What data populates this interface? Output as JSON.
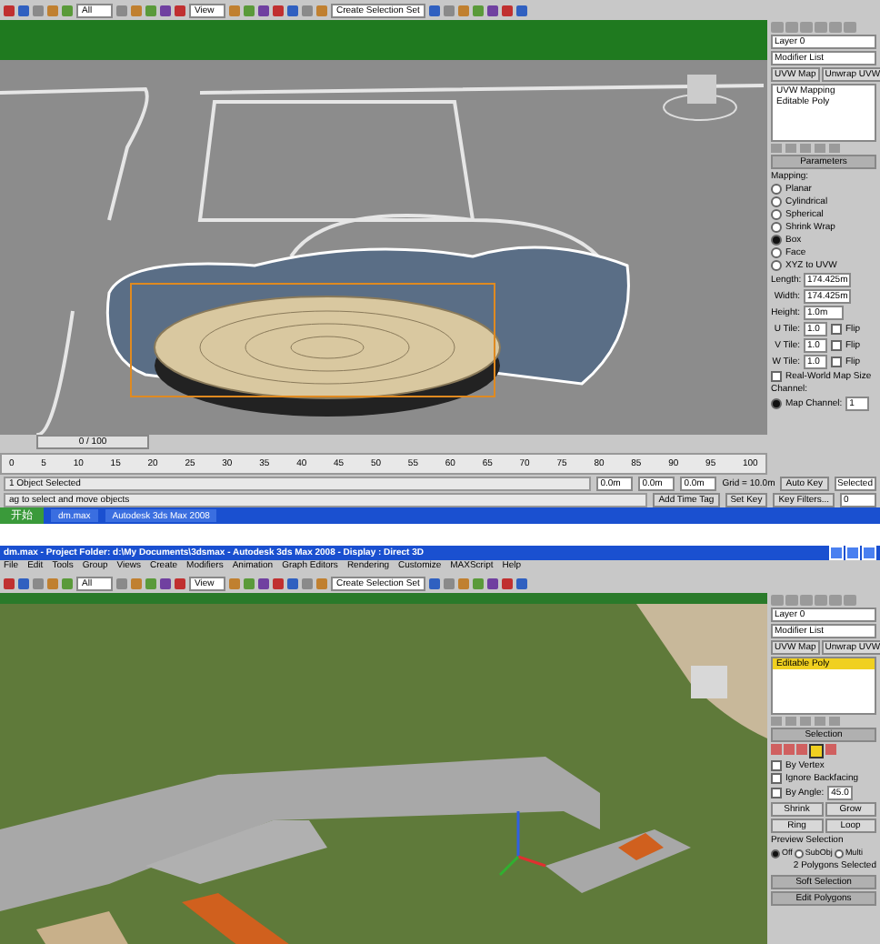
{
  "top_window": {
    "toolbar": {
      "filter": "All",
      "reference": "View",
      "selection_set": "Create Selection Set"
    },
    "panel": {
      "layer": "Layer 0",
      "modifier_list": "Modifier List",
      "buttons": [
        "UVW Map",
        "Unwrap UVW"
      ],
      "stack": [
        {
          "label": "UVW Mapping",
          "selected": false
        },
        {
          "label": "Editable Poly",
          "selected": false
        }
      ],
      "rollout": "Parameters",
      "group": "Mapping:",
      "options": [
        {
          "label": "Planar",
          "selected": false
        },
        {
          "label": "Cylindrical",
          "selected": false
        },
        {
          "label": "Spherical",
          "selected": false
        },
        {
          "label": "Shrink Wrap",
          "selected": false
        },
        {
          "label": "Box",
          "selected": true
        },
        {
          "label": "Face",
          "selected": false
        },
        {
          "label": "XYZ to UVW",
          "selected": false
        }
      ],
      "fields": [
        {
          "label": "Length:",
          "value": "174.425m"
        },
        {
          "label": "Width:",
          "value": "174.425m"
        },
        {
          "label": "Height:",
          "value": "1.0m"
        }
      ],
      "tiles": [
        {
          "label": "U Tile:",
          "value": "1.0",
          "flip": "Flip",
          "checked": false
        },
        {
          "label": "V Tile:",
          "value": "1.0",
          "flip": "Flip",
          "checked": false
        },
        {
          "label": "W Tile:",
          "value": "1.0",
          "flip": "Flip",
          "checked": false
        }
      ],
      "real_world": {
        "label": "Real-World Map Size",
        "checked": false
      },
      "channel_group": "Channel:",
      "channel": {
        "label": "Map Channel:",
        "value": "1",
        "selected": true
      }
    },
    "timeline": {
      "position": "0 / 100",
      "ticks": [
        "0",
        "5",
        "10",
        "15",
        "20",
        "25",
        "30",
        "35",
        "40",
        "45",
        "50",
        "55",
        "60",
        "65",
        "70",
        "75",
        "80",
        "85",
        "90",
        "95",
        "100"
      ]
    },
    "status": {
      "selection": "1 Object Selected",
      "prompt": "ag to select and move objects",
      "x": "0.0m",
      "y": "0.0m",
      "z": "0.0m",
      "grid": "Grid = 10.0m",
      "auto_key": "Auto Key",
      "key_mode": "Selected",
      "set_key": "Set Key",
      "key_filters": "Key Filters...",
      "add_time_tag": "Add Time Tag",
      "frame": "0"
    },
    "taskbar": {
      "start": "开始",
      "items": [
        "dm.max",
        "Autodesk 3ds Max 2008"
      ]
    }
  },
  "bottom_window": {
    "title": "dm.max - Project Folder: d:\\My Documents\\3dsmax - Autodesk 3ds Max 2008 - Display : Direct 3D",
    "menu": [
      "File",
      "Edit",
      "Tools",
      "Group",
      "Views",
      "Create",
      "Modifiers",
      "Animation",
      "Graph Editors",
      "Rendering",
      "Customize",
      "MAXScript",
      "Help"
    ],
    "toolbar": {
      "filter": "All",
      "reference": "View",
      "selection_set": "Create Selection Set"
    },
    "panel": {
      "layer": "Layer 0",
      "modifier_list": "Modifier List",
      "buttons": [
        "UVW Map",
        "Unwrap UVW"
      ],
      "stack": [
        {
          "label": "Editable Poly",
          "selected": true
        }
      ],
      "rollout": "Selection",
      "checks": [
        {
          "label": "By Vertex",
          "checked": false
        },
        {
          "label": "Ignore Backfacing",
          "checked": false
        },
        {
          "label": "By Angle:",
          "checked": false
        }
      ],
      "angle": "45.0",
      "buttons2": [
        "Shrink",
        "Grow",
        "Ring",
        "Loop"
      ],
      "preview_group": "Preview Selection",
      "preview": [
        {
          "label": "Off",
          "selected": true
        },
        {
          "label": "SubObj",
          "selected": false
        },
        {
          "label": "Multi",
          "selected": false
        }
      ],
      "info": "2 Polygons Selected",
      "rollouts": [
        "Soft Selection",
        "Edit Polygons"
      ]
    }
  }
}
